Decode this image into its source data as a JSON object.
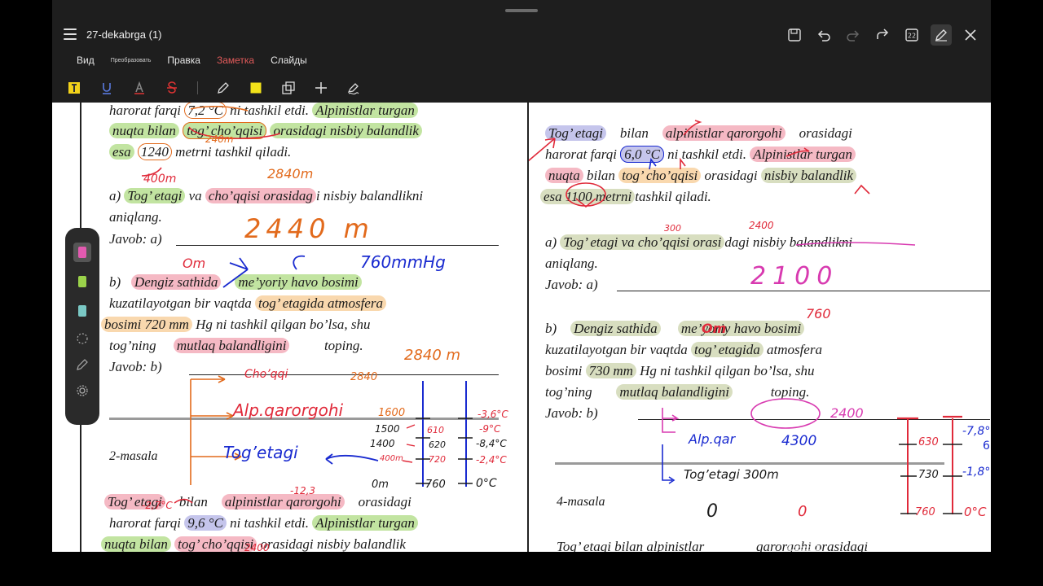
{
  "app": {
    "title": "27-dekabrga (1)",
    "menu": [
      "Вид",
      "Преобразовать",
      "Правка",
      "Заметка",
      "Слайды"
    ],
    "active_menu": "Заметка",
    "page_count_badge": "22"
  },
  "left_page": {
    "line1": "harorat farqi",
    "line1_val": "7,2 °C",
    "line1_rest": "ni tashkil etdi.",
    "line1_hl": "Alpinistlar turgan",
    "line2a": "nuqta bilan",
    "line2b": "tog’ cho’qqisi",
    "line2c": "orasidagi nisbiy balandlik",
    "line3a": "esa",
    "line3b": "1240",
    "line3c": "metrni tashkil qiladi.",
    "qa": "a)",
    "qa_hl1": "Tog’ etagi",
    "qa_mid": "va",
    "qa_hl2": "cho’qqisi orasidag",
    "qa_rest": "i nisbiy balandlikni",
    "qa_line2": "aniqlang.",
    "ans_a": "Javob: a)",
    "qb": "b)",
    "qb_hl1": "Dengiz sathida",
    "qb_hl2": "me’yoriy havo bosimi",
    "qb_l2a": "kuzatilayotgan bir vaqtda",
    "qb_l2b": "tog’ etagida atmosfera",
    "qb_l3a": "bosimi 720 mm",
    "qb_l3b": "Hg ni tashkil qilgan bo’lsa, shu",
    "qb_l4a": "tog’ning",
    "qb_l4b": "mutlaq balandligini",
    "qb_l4c": "toping.",
    "ans_b": "Javob: b)",
    "masala": "2-masala",
    "p2_l1a": "Tog’ etagi",
    "p2_l1b": "bilan",
    "p2_l1c": "alpinistlar qarorgohi",
    "p2_l1d": "orasidagi",
    "p2_l2a": "harorat farqi",
    "p2_l2b": "9,6 °C",
    "p2_l2c": "ni tashkil etdi.",
    "p2_l2d": "Alpinistlar turgan",
    "p2_l3a": "nuqta bilan",
    "p2_l3b": "tog’ cho’qqisi",
    "p2_l3c": "orasidagi nisbiy balandlik"
  },
  "left_handwriting": {
    "h_2840_top": "2840m",
    "h_400m": "400m",
    "h_2840m": "2840m",
    "h_240_small": "240m",
    "ans_2440": "2440 m",
    "om": "Om",
    "h_760": "760mmHg",
    "choqqi": "Cho’qqi",
    "alp": "Alp.qarorgohi",
    "togetagi": "Tog’etagi",
    "h_2840_b": "2840 m",
    "h_2840_c": "2840",
    "v1600": "1600",
    "v1500": "1500",
    "v1400": "1400",
    "v400m": "400m",
    "v0m": "0m",
    "p610": "610",
    "p620": "620",
    "p720": "720",
    "p760": "760",
    "t1": "-3,6°C",
    "t2": "-9°C",
    "t3": "-8,4°C",
    "t4": "-2,4°C",
    "t5": "0°C",
    "minus123": "-12,3",
    "t27": "-2,7°C",
    "v2400": "2400"
  },
  "right_page": {
    "l1a": "Tog’ etagi",
    "l1b": "bilan",
    "l1c": "alpinistlar qarorgohi",
    "l1d": "orasidagi",
    "l2a": "harorat farqi",
    "l2b": "6,0 °C",
    "l2c": "ni tashkil etdi.",
    "l2d": "Alpinistlar turgan",
    "l3a": "nuqta",
    "l3b": "bilan",
    "l3c": "tog’ cho’qqisi",
    "l3d": "orasidagi",
    "l3e": "nisbiy balandlik",
    "l4a": "esa 1100 metrni",
    "l4b": "tashkil qiladi.",
    "qa": "a)",
    "qa_hl": "Tog’ etagi va cho’qqisi orasi",
    "qa_rest": "dagi nisbiy balandlikni",
    "qa_l2": "aniqlang.",
    "ans_a": "Javob: a)",
    "qb": "b)",
    "qb_hl1": "Dengiz sathida",
    "qb_hl2": "me’yoriy havo bosimi",
    "qb_l2a": "kuzatilayotgan bir vaqtda",
    "qb_l2b": "tog’ etagida",
    "qb_l2c": "atmosfera",
    "qb_l3a": "bosimi",
    "qb_l3b": "730 mm",
    "qb_l3c": "Hg ni tashkil qilgan bo’lsa, shu",
    "qb_l4a": "tog’ning",
    "qb_l4b": "mutlaq balandligini",
    "qb_l4c": "toping.",
    "ans_b": "Javob: b)",
    "masala": "4-masala",
    "last_a": "Tog’ etagi bilan alpinistlar",
    "last_b": "qarorgohi orasidagi"
  },
  "right_handwriting": {
    "h300": "300",
    "h2400a": "2400",
    "ans_2100": "2100",
    "om": "Om",
    "h760": "760",
    "h2400b": "2400",
    "alp": "Alp.qar",
    "v4300": "4300",
    "p630": "630",
    "p730": "730",
    "p760": "760",
    "t78": "-7,8°C",
    "t18": "-1,8°C",
    "togetagi": "Tog’etagi 300m",
    "zero_a": "0",
    "zero_b": "0",
    "zero_c": "0°C",
    "side6": "6"
  },
  "watermark": "PRISM Live"
}
